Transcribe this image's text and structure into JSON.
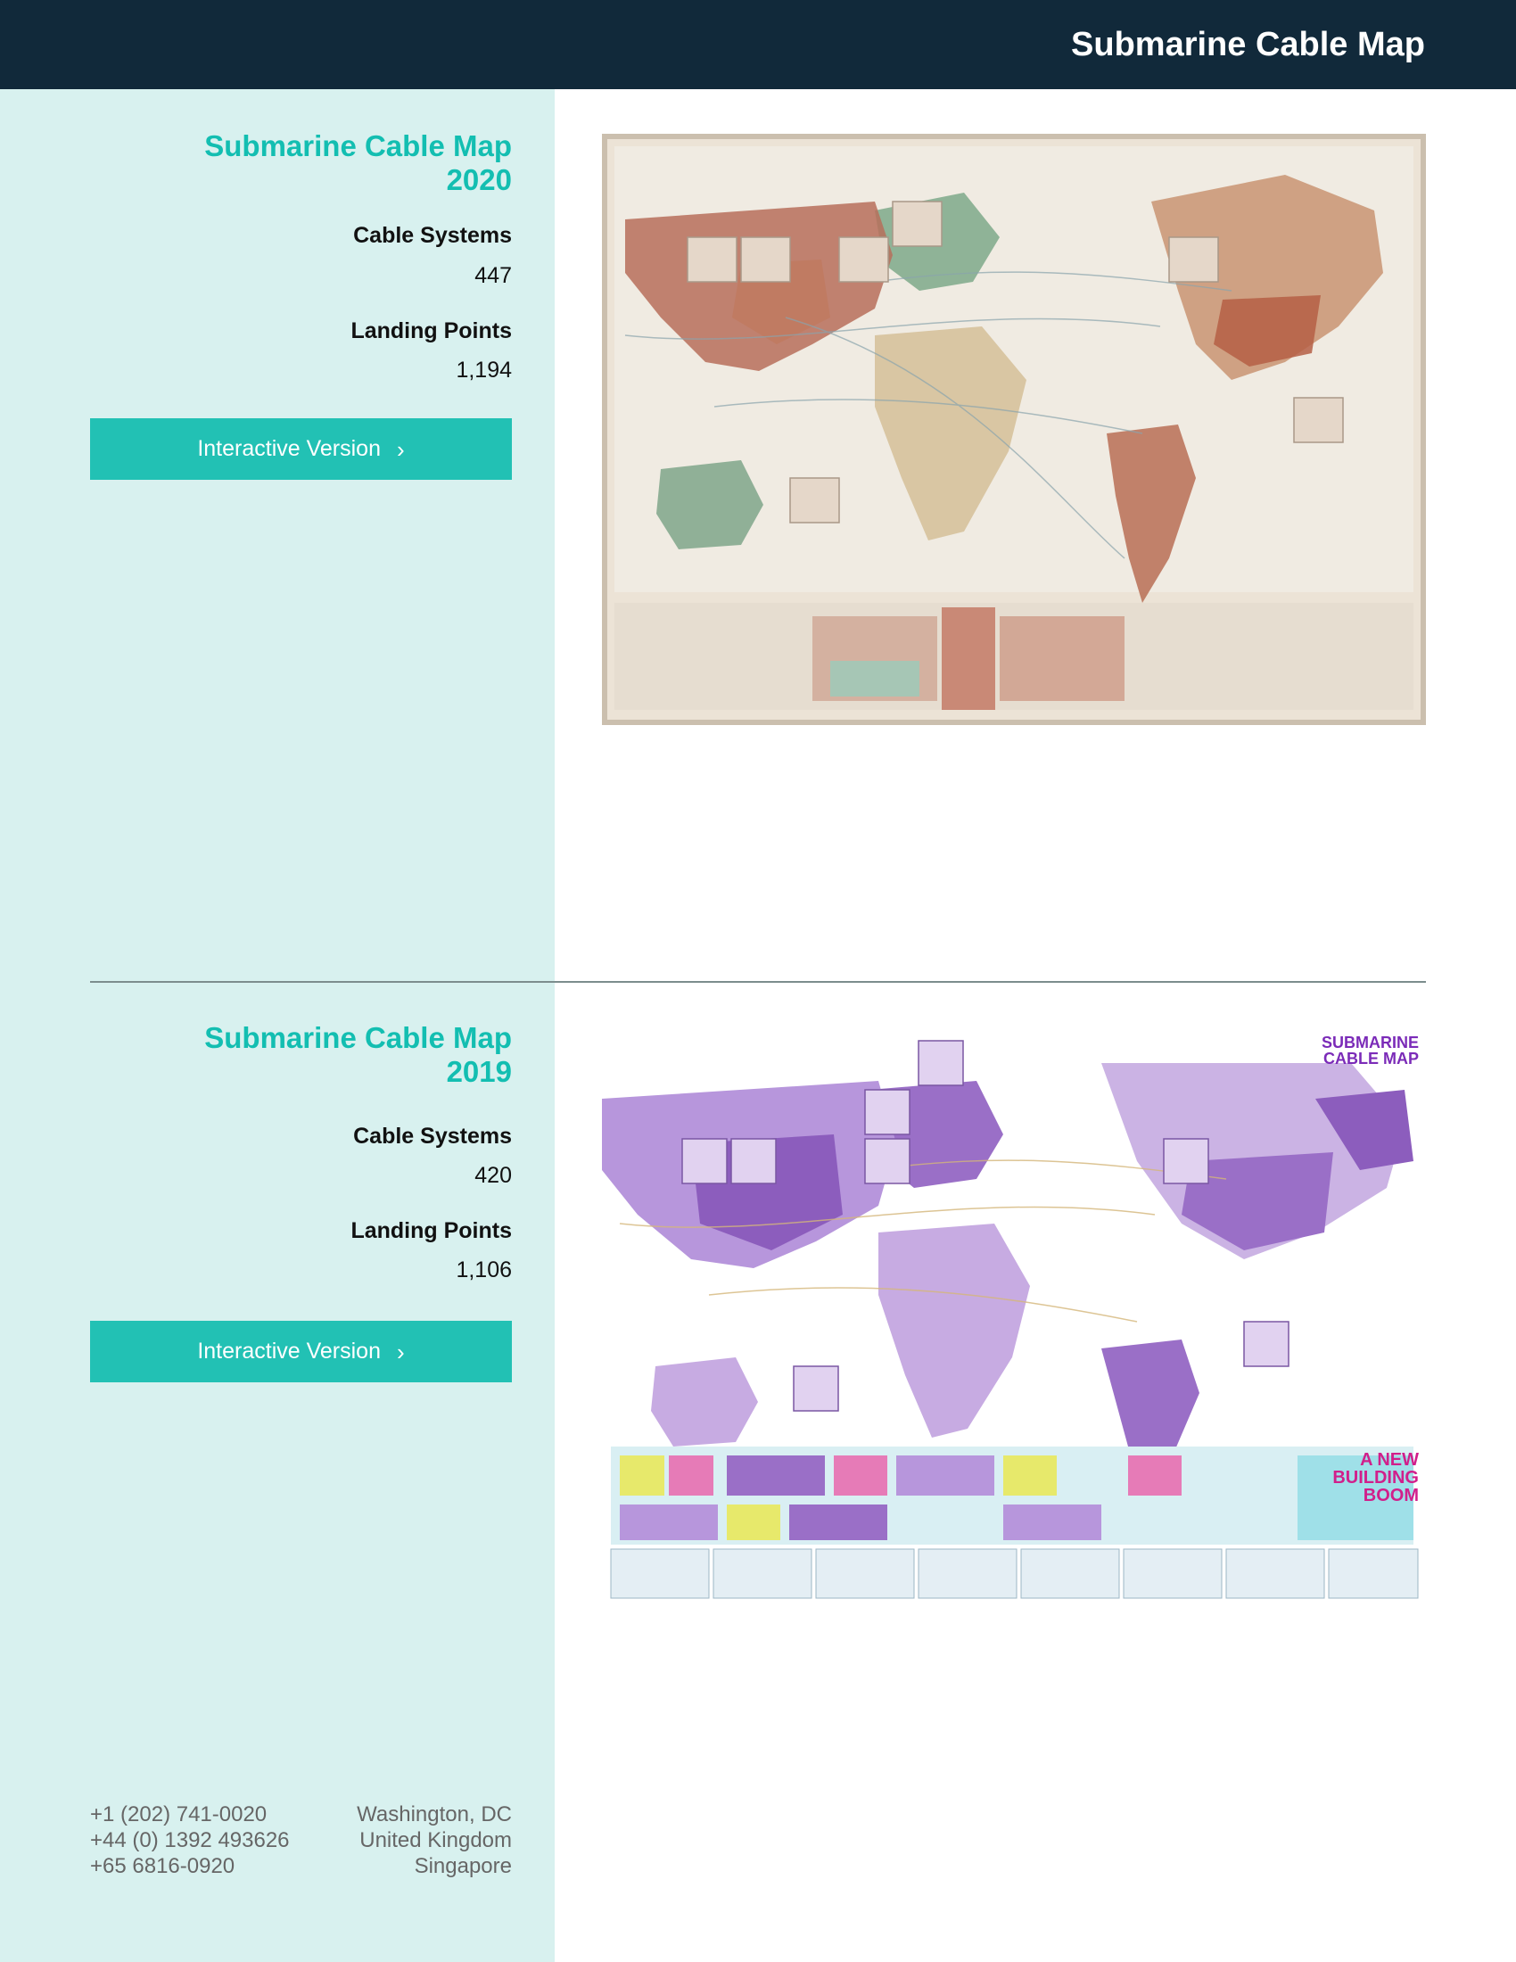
{
  "header": {
    "title": "Submarine Cable Map"
  },
  "maps": [
    {
      "title": "Submarine Cable Map\n2020",
      "stats": [
        {
          "label": "Cable Systems",
          "value": "447"
        },
        {
          "label": "Landing Points",
          "value": "1,194"
        }
      ],
      "button_label": "Interactive Version",
      "image_icon": "world-map-2020-image"
    },
    {
      "title": "Submarine Cable Map\n2019",
      "stats": [
        {
          "label": "Cable Systems",
          "value": "420"
        },
        {
          "label": "Landing Points",
          "value": "1,106"
        }
      ],
      "button_label": "Interactive Version",
      "image_icon": "world-map-2019-image",
      "poster_heading": "SUBMARINE CABLE MAP",
      "poster_subheading": "A NEW BUILDING BOOM"
    }
  ],
  "footer": {
    "cities": [
      "Washington, DC",
      "United Kingdom",
      "Singapore"
    ],
    "phones": [
      "+1 (202) 741-0020",
      "+44 (0) 1392 493626",
      "+65 6816-0920"
    ]
  },
  "colors": {
    "header_bg": "#11293a",
    "sidebar_bg": "#d8f1ef",
    "accent": "#13beb1",
    "button_bg": "#22c1b4"
  }
}
